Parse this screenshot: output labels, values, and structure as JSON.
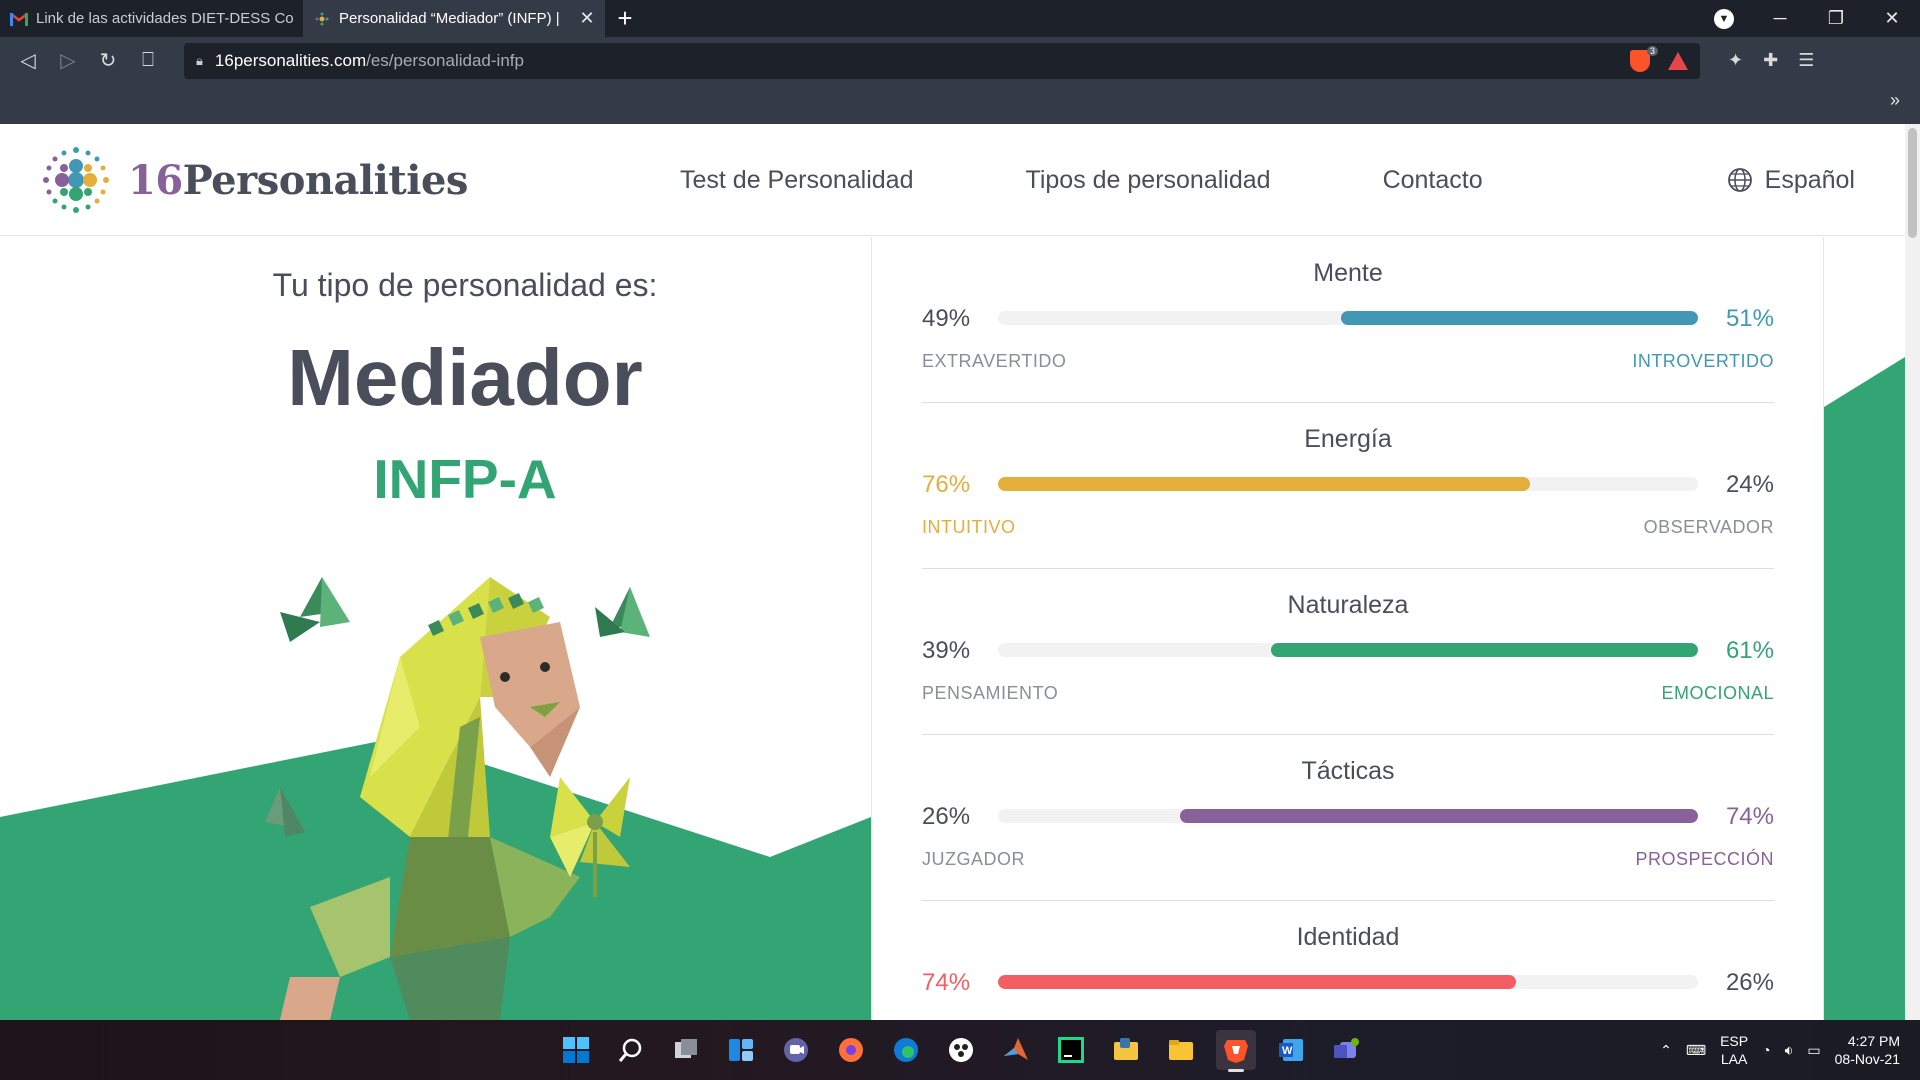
{
  "browser": {
    "tabs": [
      {
        "title": "Link de las actividades DIET-DESS Cor",
        "active": false,
        "favicon": "gmail-icon"
      },
      {
        "title": "Personalidad “Mediador” (INFP) |",
        "active": true,
        "favicon": "16p-icon"
      }
    ],
    "new_tab_label": "+",
    "url_domain": "16personalities.com",
    "url_path": "/es/personalidad-infp",
    "shield_count": "3",
    "bookmarks_more": "»"
  },
  "site": {
    "logo_num": "16",
    "logo_word": "Personalities",
    "nav": [
      "Test de Personalidad",
      "Tipos de personalidad",
      "Contacto"
    ],
    "language": "Español"
  },
  "result": {
    "subtitle": "Tu tipo de personalidad es:",
    "type_name": "Mediador",
    "type_code": "INFP-A"
  },
  "colors": {
    "green": "#33a474",
    "blue": "#4298b4",
    "yellow": "#e4ae3a",
    "purple": "#88619a",
    "red": "#f25e62"
  },
  "traits": [
    {
      "title": "Mente",
      "left_pct": "49%",
      "right_pct": "51%",
      "left_label": "EXTRAVERTIDO",
      "right_label": "INTROVERTIDO",
      "dominant": "right",
      "fill_fraction": 0.51,
      "color": "#4298b4"
    },
    {
      "title": "Energía",
      "left_pct": "76%",
      "right_pct": "24%",
      "left_label": "INTUITIVO",
      "right_label": "OBSERVADOR",
      "dominant": "left",
      "fill_fraction": 0.76,
      "color": "#e4ae3a"
    },
    {
      "title": "Naturaleza",
      "left_pct": "39%",
      "right_pct": "61%",
      "left_label": "PENSAMIENTO",
      "right_label": "EMOCIONAL",
      "dominant": "right",
      "fill_fraction": 0.61,
      "color": "#33a474"
    },
    {
      "title": "Tácticas",
      "left_pct": "26%",
      "right_pct": "74%",
      "left_label": "JUZGADOR",
      "right_label": "PROSPECCIÓN",
      "dominant": "right",
      "fill_fraction": 0.74,
      "color": "#88619a"
    },
    {
      "title": "Identidad",
      "left_pct": "74%",
      "right_pct": "26%",
      "left_label": "",
      "right_label": "",
      "dominant": "left",
      "fill_fraction": 0.74,
      "color": "#f25e62"
    }
  ],
  "taskbar": {
    "icons": [
      "windows-start-icon",
      "search-icon",
      "task-view-icon",
      "widgets-icon",
      "teams-chat-icon",
      "firefox-icon",
      "edge-icon",
      "davinci-icon",
      "matlab-icon",
      "pycharm-icon",
      "python-icon",
      "file-explorer-icon",
      "brave-icon",
      "word-icon",
      "teams-icon"
    ],
    "lang_line1": "ESP",
    "lang_line2": "LAA",
    "time": "4:27 PM",
    "date": "08-Nov-21"
  }
}
